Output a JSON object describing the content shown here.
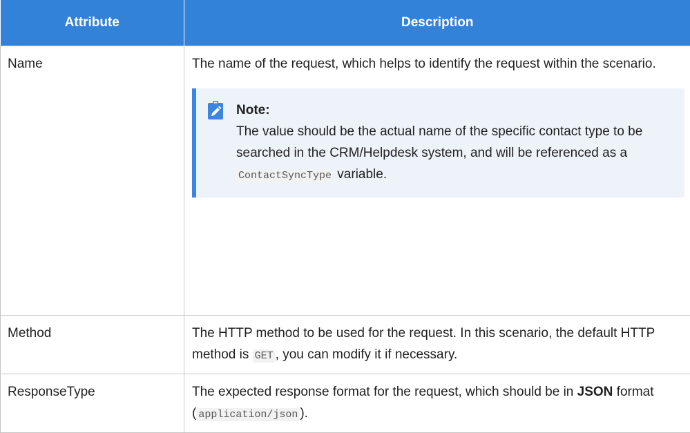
{
  "table": {
    "headers": [
      "Attribute",
      "Description"
    ],
    "rows": [
      {
        "attribute": "Name",
        "description": "The name of the request, which helps to identify the request within the scenario.",
        "note": {
          "title": "Note:",
          "text_before": "The value should be the actual name of the specific contact type to be searched in the CRM/Helpdesk system, and will be referenced as a ",
          "code": "ContactSyncType",
          "text_after": " variable.",
          "icon": "edit-note-icon",
          "accent_color": "#3d86e0"
        }
      },
      {
        "attribute": "Method",
        "description_before": "The HTTP method to be used for the request. In this scenario, the default HTTP method is ",
        "code": "GET",
        "description_after": ", you can modify it if necessary."
      },
      {
        "attribute": "ResponseType",
        "description_before": "The expected response format for the request, which should be in ",
        "bold": "JSON",
        "description_middle": " format (",
        "code": "application/json",
        "description_after": ")."
      }
    ]
  },
  "colors": {
    "header_bg": "#3282d9",
    "header_text": "#ffffff",
    "note_bg": "#eef3fa",
    "border": "#c4c4c4"
  }
}
